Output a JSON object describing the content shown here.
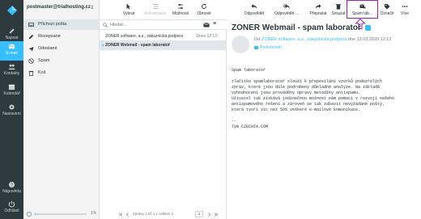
{
  "rail": {
    "items": [
      {
        "label": "Napsat",
        "icon": "compose-icon"
      },
      {
        "label": "E-mail",
        "icon": "mail-icon"
      },
      {
        "label": "Kontakty",
        "icon": "contacts-icon"
      },
      {
        "label": "Kalendář",
        "icon": "calendar-icon"
      },
      {
        "label": "Nastavení",
        "icon": "gear-icon"
      },
      {
        "label": "Nápověda",
        "icon": "help-icon"
      },
      {
        "label": "Odhlásit",
        "icon": "power-icon"
      }
    ],
    "active_color": "#37beff"
  },
  "account": {
    "email": "postmaster@trialhosting.cz",
    "menu": "⋮"
  },
  "folders": [
    {
      "label": "Příchozí pošta",
      "icon": "inbox-icon"
    },
    {
      "label": "Rozepsané",
      "icon": "pencil-icon"
    },
    {
      "label": "Odeslané",
      "icon": "send-icon"
    },
    {
      "label": "Spam",
      "icon": "spam-icon"
    },
    {
      "label": "Koš",
      "icon": "trash-icon"
    }
  ],
  "quota": {
    "percent_text": "1%",
    "fill_fraction": 0.01
  },
  "mid_toolbar": {
    "select": "Vybrat",
    "threads": "Konverzace",
    "options": "Možnosti",
    "refresh": "Obnovit"
  },
  "search": {
    "placeholder": "Hledat...",
    "menu": "≡"
  },
  "messages": [
    {
      "from": "ZONER software, a.s., zákaznická podpora",
      "date": "Dnes 12:12",
      "subject": ""
    },
    {
      "from": "",
      "date": "",
      "subject": "ZONER Webmail - spam laboratoř"
    }
  ],
  "list_footer": {
    "count_text": "Zprávy 1 až 1 z celkem 1",
    "page": "1"
  },
  "right_toolbar": {
    "reply": "Odpovědět",
    "reply_all": "Odpovědět ...",
    "forward": "Přeposlat",
    "delete": "Smazat",
    "spam_lab": "Spam lab...",
    "mark": "Označit",
    "more": "Více"
  },
  "message": {
    "subject": "ZONER Webmail - spam laboratoř",
    "from_prefix": "Od",
    "from_name": "ZONER software, a.s., zákaznická podpora",
    "date": "dne 13.03.2020 12:12",
    "details": "Podrobnosti",
    "body": "Spam laboratoř\n\ntlačítko spamlaboratoř slouží k přeposílání vzorků podezřelých\nzpráv, které jsou dále podrobeny důkladné analýze. Na základě\nvyhodnocení jsou prováděny úpravy metodiky antispamu.\nUživatel tak získává jedinečnou možnost nám pomoci v rozvoji našeho\nantispamového řešení a zároveň se tak zabavit nevyžádané pošty,\nkterá tvoří víc než 50% veškeré e-mailové komunikace.\n\n-- \nTým CZECHIA.COM"
  },
  "annotation_color": "#a020b8"
}
